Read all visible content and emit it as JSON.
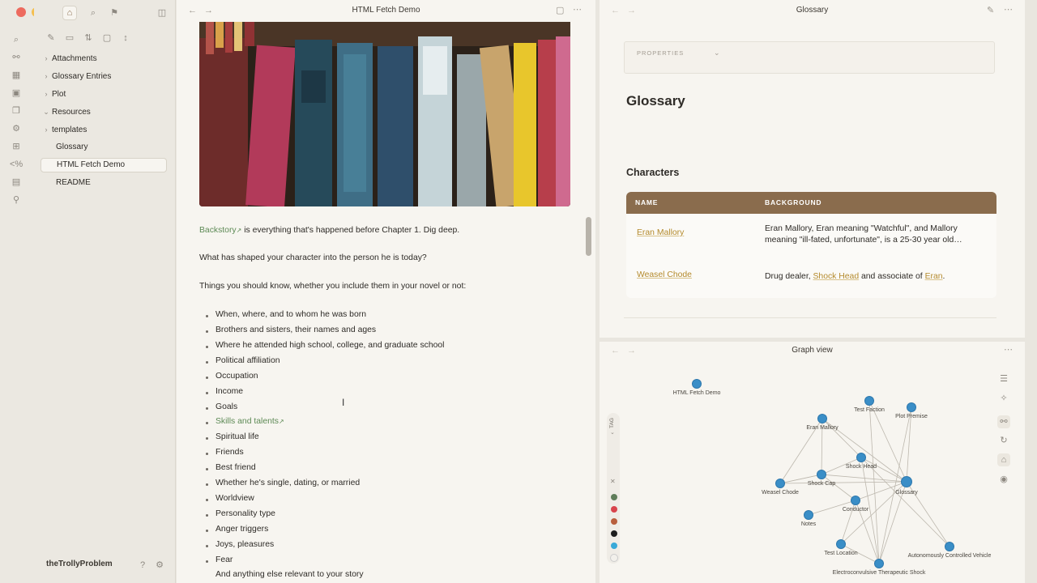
{
  "sidebar": {
    "items": [
      {
        "label": "Attachments",
        "folder": true,
        "open": false
      },
      {
        "label": "Glossary Entries",
        "folder": true,
        "open": false
      },
      {
        "label": "Plot",
        "folder": true,
        "open": false
      },
      {
        "label": "Resources",
        "folder": true,
        "open": true
      },
      {
        "label": "templates",
        "folder": true,
        "open": false
      },
      {
        "label": "Glossary",
        "folder": false
      },
      {
        "label": "HTML Fetch Demo",
        "folder": false,
        "active": true
      },
      {
        "label": "README",
        "folder": false
      }
    ],
    "vault_name": "theTrollyProblem"
  },
  "center": {
    "title": "HTML Fetch Demo",
    "backstory_link": "Backstory",
    "backstory_rest": " is everything that's happened before Chapter 1. Dig deep.",
    "para2": "What has shaped your character into the person he is today?",
    "para3": "Things you should know, whether you include them in your novel or not:",
    "list": [
      "When, where, and to whom he was born",
      "Brothers and sisters, their names and ages",
      "Where he attended high school, college, and graduate school",
      "Political affiliation",
      "Occupation",
      "Income",
      "Goals",
      "Skills and talents",
      "Spiritual life",
      "Friends",
      "Best friend",
      "Whether he's single, dating, or married",
      "Worldview",
      "Personality type",
      "Anger triggers",
      "Joys, pleasures",
      "Fear",
      "And anything else relevant to your story"
    ]
  },
  "glossary": {
    "tab_title": "Glossary",
    "properties_label": "PROPERTIES",
    "heading": "Glossary",
    "section": "Characters",
    "col_name": "NAME",
    "col_background": "BACKGROUND",
    "row1_name": "Eran Mallory",
    "row1_bg": "Eran Mallory, Eran meaning \"Watchful\", and Mallory meaning \"ill-fated, unfortunate\", is a 25-30 year old…",
    "row2_name": "Weasel Chode",
    "row2_bg_a": "Drug dealer, ",
    "row2_bg_link1": "Shock Head",
    "row2_bg_b": " and associate of ",
    "row2_bg_link2": "Eran",
    "row2_bg_c": "."
  },
  "graph": {
    "title": "Graph view",
    "tag_label": "TAG",
    "nodes": [
      "HTML Fetch Demo",
      "Test Faction",
      "Plot Premise",
      "Eran Mallory",
      "Shock Head",
      "Shock Cap",
      "Glossary",
      "Weasel Chode",
      "Conductor",
      "Notes",
      "Test Location",
      "Autonomously Controlled Vehicle",
      "Electroconvulsive Therapeutic Shock"
    ],
    "tag_colors": [
      "#5f7d5a",
      "#d8434c",
      "#b85e3c",
      "#1d1d1d",
      "#38a9d8",
      "#f2f0eb"
    ]
  }
}
